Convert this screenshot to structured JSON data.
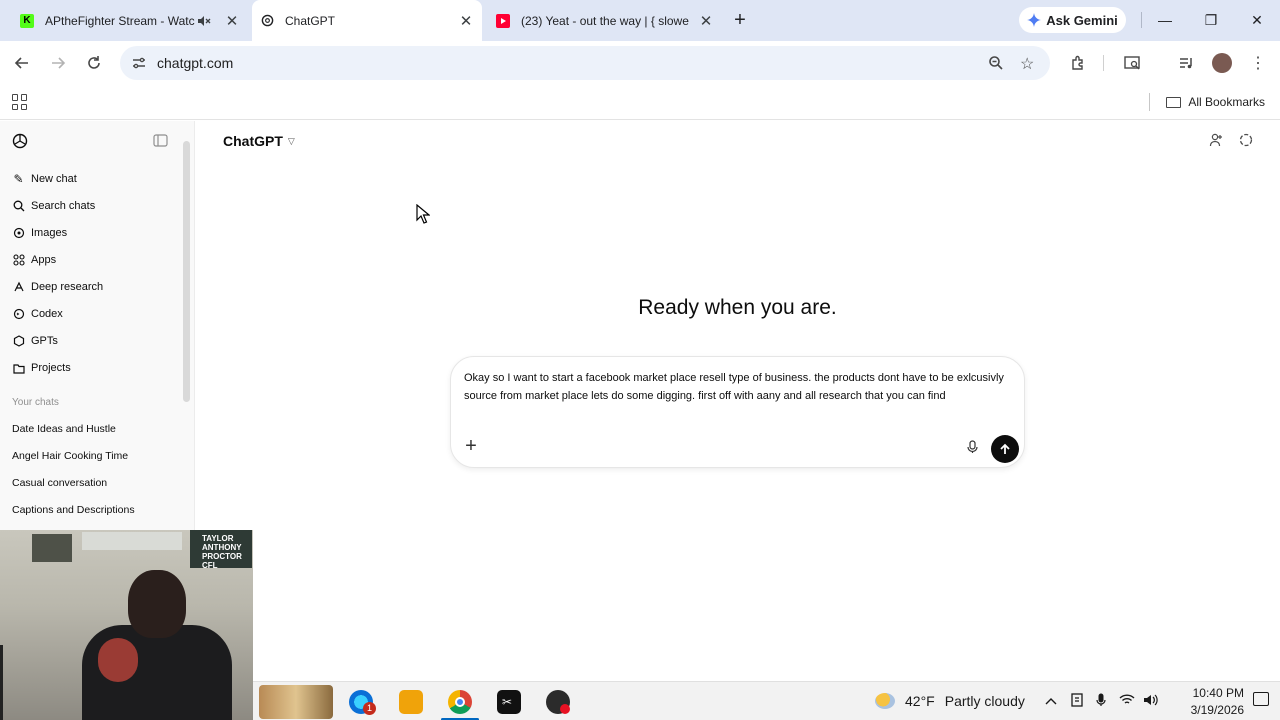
{
  "browser": {
    "tabs": [
      {
        "title": "APtheFighter Stream - Watc",
        "icon": "kick-favicon",
        "muted": true
      },
      {
        "title": "ChatGPT",
        "icon": "chatgpt-favicon",
        "active": true
      },
      {
        "title": "(23) Yeat - out the way | { slowe",
        "icon": "youtube-favicon"
      }
    ],
    "ask_gemini": "Ask Gemini",
    "url": "chatgpt.com",
    "all_bookmarks": "All Bookmarks"
  },
  "sidebar": {
    "items": [
      {
        "label": "New chat",
        "icon": "new-chat-icon"
      },
      {
        "label": "Search chats",
        "icon": "search-icon"
      },
      {
        "label": "Images",
        "icon": "images-icon"
      },
      {
        "label": "Apps",
        "icon": "apps-icon"
      },
      {
        "label": "Deep research",
        "icon": "deep-research-icon"
      },
      {
        "label": "Codex",
        "icon": "codex-icon"
      },
      {
        "label": "GPTs",
        "icon": "gpts-icon"
      },
      {
        "label": "Projects",
        "icon": "folder-icon"
      }
    ],
    "your_chats_label": "Your chats",
    "chats": [
      "Date Ideas and Hustle",
      "Angel Hair Cooking Time",
      "Casual conversation",
      "Captions and Descriptions"
    ]
  },
  "main": {
    "model_label": "ChatGPT",
    "heading": "Ready when you are.",
    "prompt_text": "Okay so I want to start a facebook market place resell type of business. the products dont have to be exlcusivly source from market place lets do some digging. first off with aany and all research that you can find"
  },
  "webcam": {
    "poster_text": "TAYLOR ANTHONY PROCTOR CFL"
  },
  "taskbar": {
    "chrome_badge": "1",
    "temperature": "42°F",
    "weather": "Partly cloudy",
    "time": "10:40 PM",
    "date": "3/19/2026"
  },
  "colors": {
    "tabstrip_bg": "#dfe6f5",
    "omnibox_bg": "#edf2fa",
    "sidebar_bg": "#f9f9f9",
    "send_button": "#0d0d0d",
    "kick_green": "#53fc18",
    "youtube_red": "#ff0033"
  }
}
